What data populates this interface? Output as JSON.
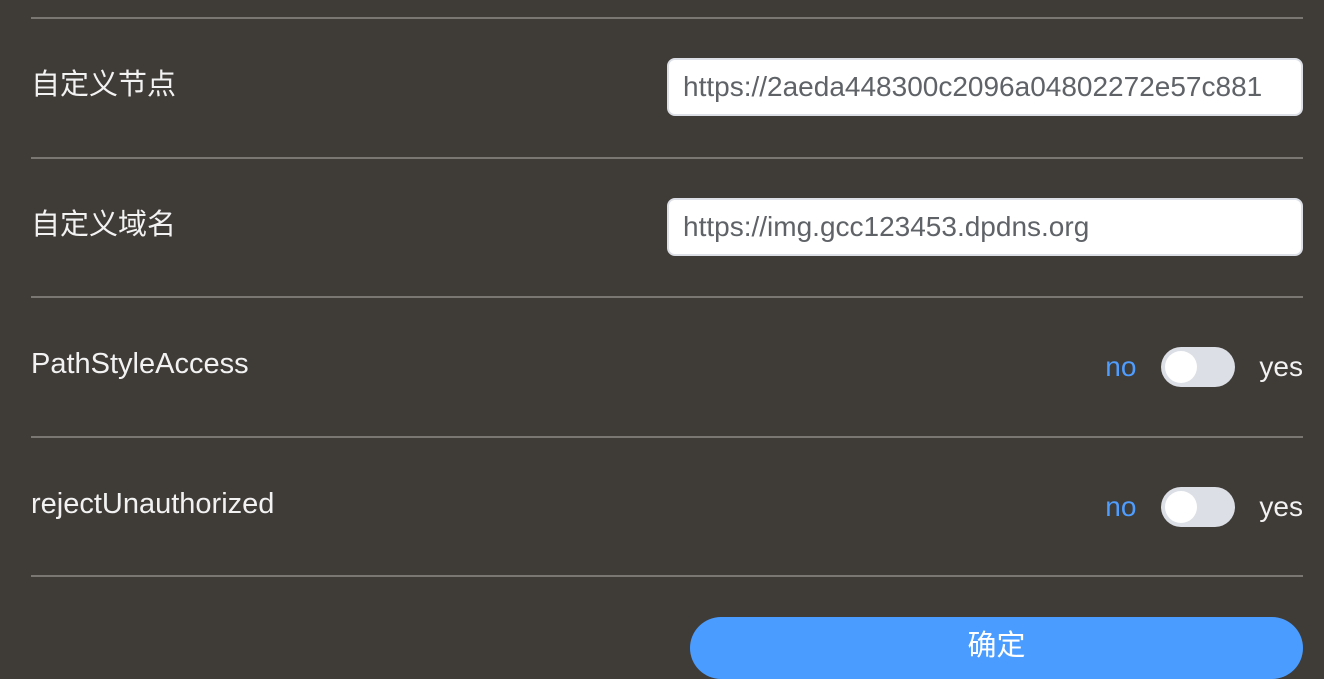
{
  "fields": {
    "custom_node": {
      "label": "自定义节点",
      "value": "https://2aeda448300c2096a04802272e57c881"
    },
    "custom_domain": {
      "label": "自定义域名",
      "value": "https://img.gcc123453.dpdns.org"
    }
  },
  "switches": {
    "path_style_access": {
      "label": "PathStyleAccess",
      "off_text": "no",
      "on_text": "yes",
      "checked": false
    },
    "reject_unauthorized": {
      "label": "rejectUnauthorized",
      "off_text": "no",
      "on_text": "yes",
      "checked": false
    }
  },
  "actions": {
    "confirm_label": "确定"
  },
  "colors": {
    "background": "#3f3b37",
    "accent": "#4a9cff",
    "inactive_text": "#4f9dff",
    "switch_off": "#dcdfe6"
  }
}
